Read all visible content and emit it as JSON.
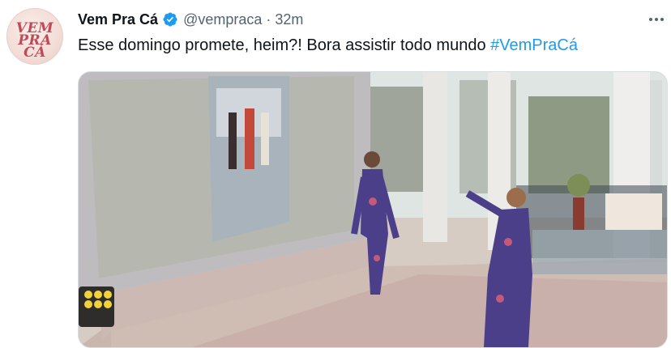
{
  "tweet": {
    "avatar": {
      "logo_text": "VEM PRA CÁ",
      "colors": {
        "logo": "#c04a57",
        "background": "#f3dcd6"
      }
    },
    "display_name": "Vem Pra Cá",
    "verified_icon": "verified-badge-icon",
    "handle": "@vempraca",
    "separator": "·",
    "time": "32m",
    "more_icon": "more-options-icon",
    "text_plain": "Esse domingo promete, heim?! Bora assistir todo mundo ",
    "hashtag": "#VemPraCá",
    "media": {
      "type": "video",
      "content": "studio-dance-scene"
    }
  },
  "colors": {
    "text_primary": "#0f1419",
    "text_secondary": "#536471",
    "link": "#1d9bf0",
    "verified": "#1d9bf0"
  }
}
